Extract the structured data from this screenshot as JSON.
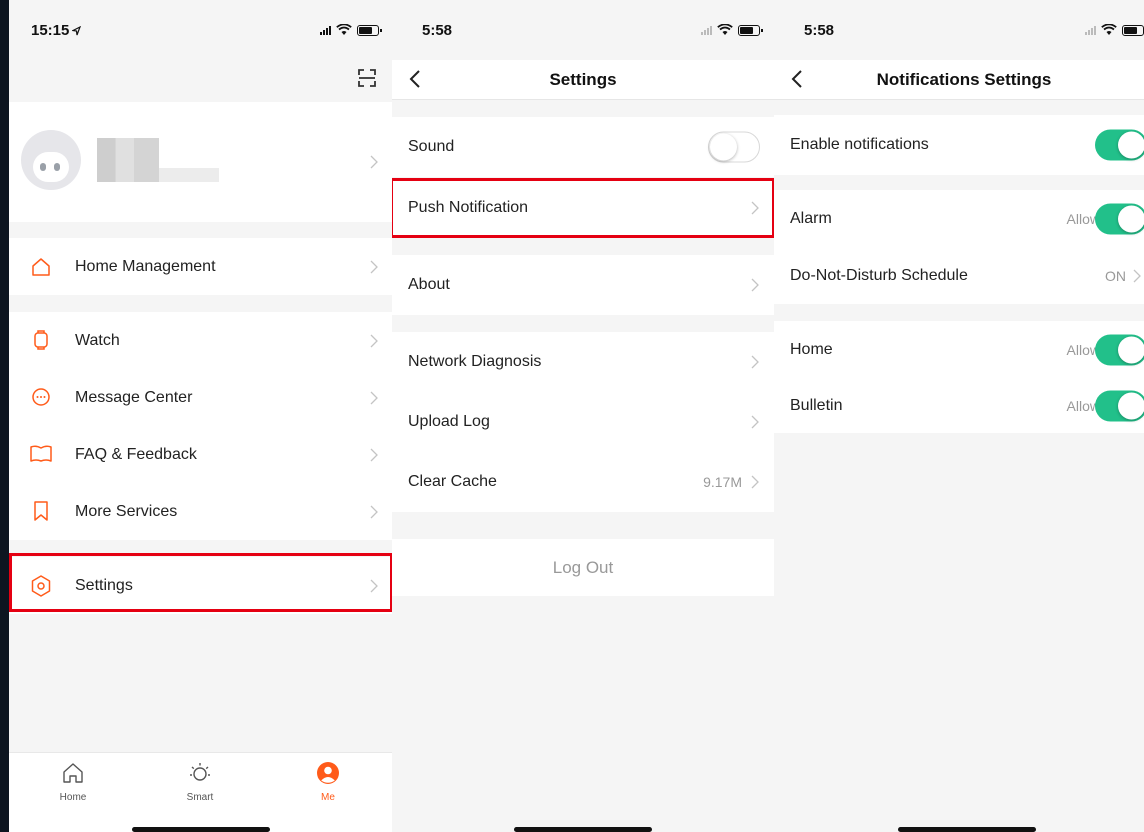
{
  "screen_me": {
    "time": "15:15",
    "tabs": [
      {
        "label": "Home",
        "icon": "house-icon"
      },
      {
        "label": "Smart",
        "icon": "sun-icon"
      },
      {
        "label": "Me",
        "icon": "person-icon",
        "active": true
      }
    ],
    "menu": [
      {
        "label": "Home Management",
        "icon": "house-outline-icon"
      },
      {
        "label": "Watch",
        "icon": "watch-icon"
      },
      {
        "label": "Message Center",
        "icon": "chat-bubble-icon"
      },
      {
        "label": "FAQ & Feedback",
        "icon": "book-icon"
      },
      {
        "label": "More Services",
        "icon": "bookmark-icon"
      },
      {
        "label": "Settings",
        "icon": "hexagon-settings-icon"
      }
    ]
  },
  "screen_settings": {
    "time": "5:58",
    "title": "Settings",
    "rows": [
      {
        "label": "Sound",
        "toggle": "off"
      },
      {
        "label": "Push Notification"
      },
      {
        "label": "About"
      },
      {
        "label": "Network Diagnosis"
      },
      {
        "label": "Upload Log"
      },
      {
        "label": "Clear Cache",
        "value": "9.17M"
      }
    ],
    "logout": "Log Out"
  },
  "screen_notifications": {
    "time": "5:58",
    "title": "Notifications Settings",
    "rows": [
      {
        "label": "Enable notifications",
        "toggle": "on"
      },
      {
        "label": "Alarm",
        "value": "Allow",
        "toggle": "on"
      },
      {
        "label": "Do-Not-Disturb Schedule",
        "value": "ON"
      },
      {
        "label": "Home",
        "value": "Allow",
        "toggle": "on"
      },
      {
        "label": "Bulletin",
        "value": "Allow",
        "toggle": "on"
      }
    ]
  },
  "colors": {
    "accent": "#ff5b1a",
    "toggle_on": "#22c08a",
    "highlight": "#e50012"
  }
}
